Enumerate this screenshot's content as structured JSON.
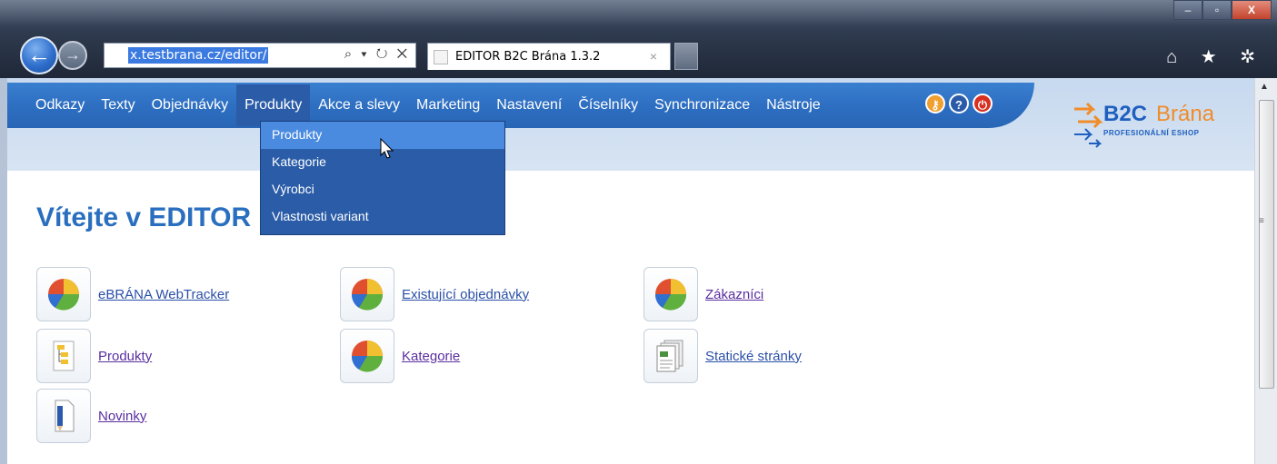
{
  "browser": {
    "url": "x.testbrana.cz/editor/",
    "tab_title": "EDITOR B2C Brána 1.3.2",
    "tab_close": "×",
    "address_tools": "⌕ ▾ ↻ ✕",
    "window_buttons": {
      "minimize": "–",
      "maximize": "▫",
      "close": "X"
    },
    "toolbar_icons": "⌂ ★ ✲"
  },
  "nav": {
    "items": [
      {
        "label": "Odkazy"
      },
      {
        "label": "Texty"
      },
      {
        "label": "Objednávky"
      },
      {
        "label": "Produkty"
      },
      {
        "label": "Akce a slevy"
      },
      {
        "label": "Marketing"
      },
      {
        "label": "Nastavení"
      },
      {
        "label": "Číselníky"
      },
      {
        "label": "Synchronizace"
      },
      {
        "label": "Nástroje"
      }
    ],
    "active_index": 3
  },
  "dropdown": {
    "items": [
      {
        "label": "Produkty"
      },
      {
        "label": "Kategorie"
      },
      {
        "label": "Výrobci"
      },
      {
        "label": "Vlastnosti variant"
      }
    ],
    "hover_index": 0
  },
  "logo": {
    "brand_b2c": "B2C",
    "brand_brana": "Brána",
    "tagline": "PROFESIONÁLNÍ ESHOP"
  },
  "main": {
    "welcome": "Vítejte v EDITOR",
    "links": [
      {
        "label": "eBRÁNA WebTracker",
        "icon": "pie-chart-icon"
      },
      {
        "label": "Existující objednávky",
        "icon": "pie-chart-icon"
      },
      {
        "label": "Zákazníci",
        "icon": "pie-chart-icon"
      },
      {
        "label": "Produkty",
        "icon": "tree-document-icon"
      },
      {
        "label": "Kategorie",
        "icon": "pie-chart-icon"
      },
      {
        "label": "Statické stránky",
        "icon": "pages-icon"
      },
      {
        "label": "Novinky",
        "icon": "pen-document-icon"
      }
    ]
  },
  "colors": {
    "nav_blue": "#2e6fc2",
    "header_light": "#c7d9ef",
    "welcome_blue": "#2a6fbf",
    "link_visited": "#5a2ea0",
    "link_blue": "#2a4fa8"
  }
}
